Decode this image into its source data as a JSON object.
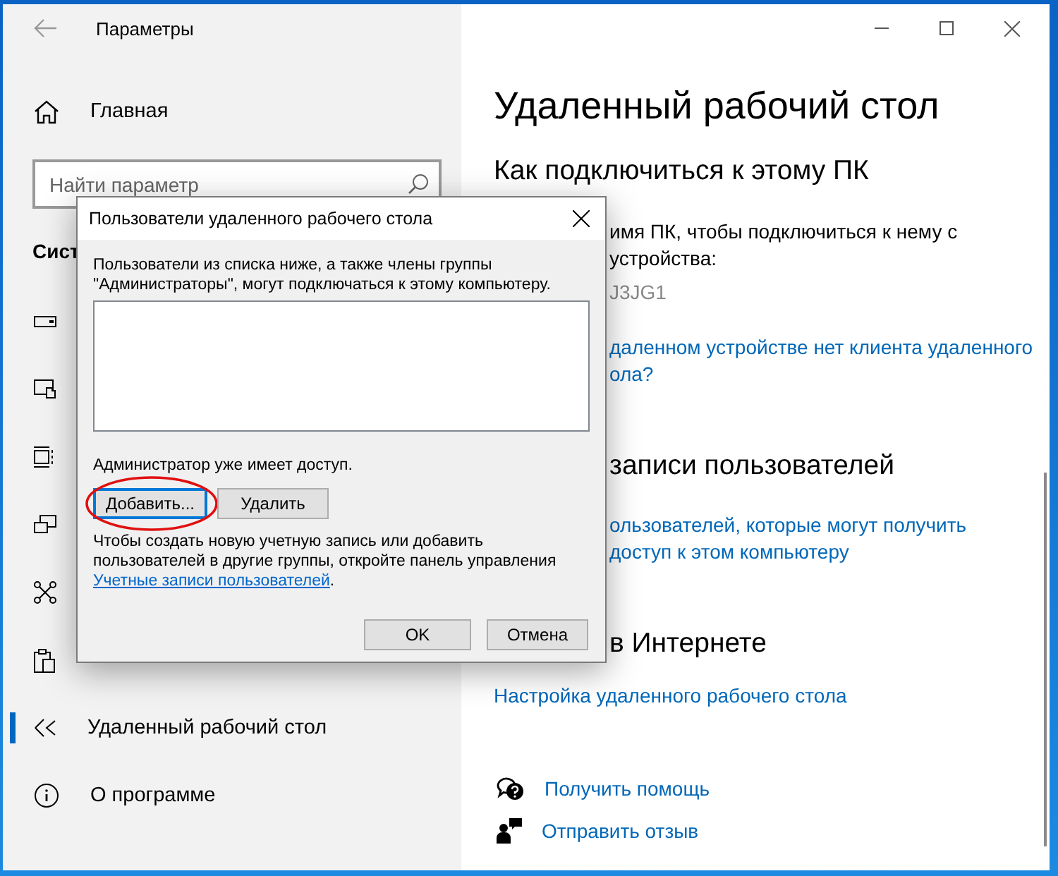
{
  "window": {
    "title": "Параметры"
  },
  "sidebar": {
    "home": "Главная",
    "search": {
      "placeholder": "Найти параметр"
    },
    "section": "Сист",
    "items": [
      {
        "selected": false
      },
      {
        "selected": false
      },
      {
        "selected": false
      },
      {
        "selected": false
      },
      {
        "selected": false
      },
      {
        "selected": false
      },
      {
        "label": "Удаленный рабочий стол",
        "selected": true
      },
      {
        "label": "О программе",
        "selected": false
      }
    ]
  },
  "content": {
    "title": "Удаленный рабочий стол",
    "blocks": [
      {
        "kind": "heading",
        "covered": false,
        "lines": [
          "Как подключиться к этому ПК"
        ]
      },
      {
        "kind": "text",
        "covered": true,
        "lines": [
          "имя ПК, чтобы подключиться к нему с",
          "устройства:"
        ]
      },
      {
        "kind": "value",
        "covered": true,
        "lines": [
          "J3JG1"
        ]
      },
      {
        "kind": "link",
        "covered": true,
        "lines": [
          "даленном устройстве нет клиента удаленного",
          "ола?"
        ]
      },
      {
        "kind": "heading",
        "covered": true,
        "lines": [
          "записи пользователей"
        ]
      },
      {
        "kind": "link",
        "covered": true,
        "lines": [
          "ользователей, которые могут получить",
          "доступ к этом компьютеру"
        ]
      },
      {
        "kind": "heading",
        "covered": true,
        "lines": [
          "в Интернете"
        ]
      },
      {
        "kind": "link",
        "covered": false,
        "lines": [
          "Настройка удаленного рабочего стола"
        ]
      }
    ],
    "help": [
      {
        "label": "Получить помощь"
      },
      {
        "label": "Отправить отзыв"
      }
    ]
  },
  "dialog": {
    "title": "Пользователи удаленного рабочего стола",
    "intro": "Пользователи из списка ниже, а также члены группы \"Администраторы\", могут подключаться к этому компьютеру.",
    "status": "Администратор уже имеет доступ.",
    "actions": [
      {
        "label": "Добавить...",
        "focused": true,
        "circled": true
      },
      {
        "label": "Удалить",
        "focused": false,
        "circled": false
      }
    ],
    "note": {
      "text": "Чтобы создать новую учетную запись или добавить пользователей в другие группы, откройте панель управления",
      "link": "Учетные записи пользователей",
      "end": "."
    },
    "buttons": [
      {
        "label": "OK"
      },
      {
        "label": "Отмена"
      }
    ]
  }
}
